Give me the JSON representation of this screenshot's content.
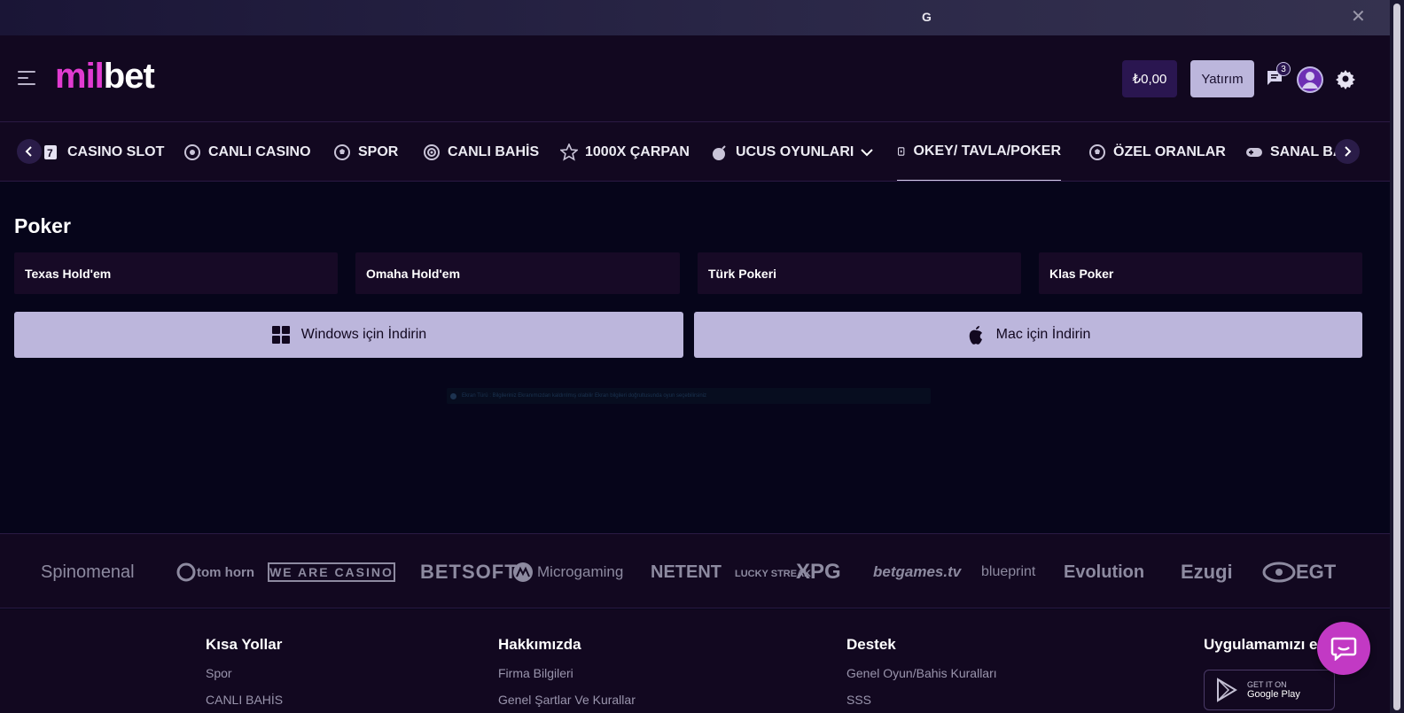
{
  "top_strip": {
    "mark": "G"
  },
  "header": {
    "logo_pink": "mil",
    "logo_white": "bet",
    "balance": "₺0,00",
    "deposit_label": "Yatırım",
    "chat_badge": "3"
  },
  "nav": {
    "items": [
      {
        "label": "CASINO SLOT",
        "icon": "slot-icon"
      },
      {
        "label": "CANLI CASINO",
        "icon": "roulette-icon"
      },
      {
        "label": "SPOR",
        "icon": "soccer-ball-icon"
      },
      {
        "label": "CANLI BAHİS",
        "icon": "live-broadcast-icon"
      },
      {
        "label": "1000X ÇARPAN",
        "icon": "star-icon"
      },
      {
        "label": "UCUS OYUNLARI",
        "icon": "bomb-icon"
      },
      {
        "label": "OKEY/ TAVLA/POKER",
        "icon": "cards-icon"
      },
      {
        "label": "ÖZEL ORANLAR",
        "icon": "soccer-ball-icon"
      },
      {
        "label": "SANAL BA",
        "icon": "gamepad-icon"
      }
    ],
    "active_index": 6
  },
  "content": {
    "section_title": "Poker",
    "games": [
      "Texas Hold'em",
      "Omaha Hold'em",
      "Türk Pokeri",
      "Klas Poker"
    ],
    "download_windows": "Windows için İndirin",
    "download_mac": "Mac için İndirin",
    "info_text": "Ekran Türü : Bilgileriniz Ekranımızdan kaldırılmış olabilir Ekran bilgileri doğrultusunda oyun seçebilirsiniz"
  },
  "providers": [
    "Spinomenal",
    "tom horn",
    "WE ARE CASINO",
    "BETSOFT",
    "Microgaming",
    "NETENT",
    "LUCKY STREAK",
    "XPG",
    "betgames.tv",
    "blueprint",
    "Evolution",
    "Ezugi",
    "EGT"
  ],
  "footer": {
    "col1": {
      "title": "Kısa Yollar",
      "links": [
        "Spor",
        "CANLI BAHİS"
      ]
    },
    "col2": {
      "title": "Hakkımızda",
      "links": [
        "Firma Bilgileri",
        "Genel Şartlar Ve Kurallar"
      ]
    },
    "col3": {
      "title": "Destek",
      "links": [
        "Genel Oyun/Bahis Kuralları",
        "SSS"
      ]
    },
    "col4": {
      "title": "Uygulamamızı edi"
    },
    "gplay_small": "GET IT ON",
    "gplay_big": "Google Play"
  },
  "colors": {
    "accent_pink": "#e13bd1",
    "button_lavender": "#bcb6dc",
    "background": "#06051a",
    "panel": "#120820",
    "chat_bubble": "#c239c4"
  }
}
